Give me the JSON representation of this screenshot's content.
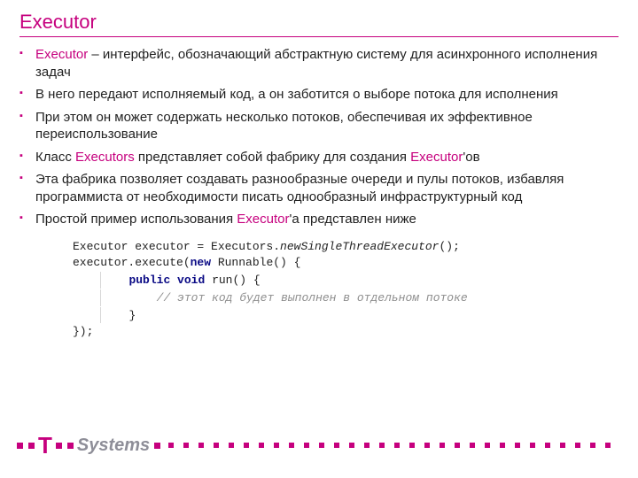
{
  "title": "Executor",
  "bullets": [
    {
      "pre": "Executor",
      "post": " – интерфейс, обозначающий абстрактную систему для асинхронного исполнения задач"
    },
    {
      "plain": "В него передают исполняемый код, а он заботится о выборе потока для исполнения"
    },
    {
      "plain": "При этом он может содержать несколько потоков, обеспечивая их эффективное переиспользование"
    },
    {
      "p1": "Класс ",
      "k1": "Executors",
      "p2": " представляет собой фабрику для создания ",
      "k2": "Executor",
      "p3": "'ов"
    },
    {
      "plain": "Эта фабрика позволяет создавать разнообразные очереди и пулы потоков, избавляя программиста от необходимости писать однообразный инфраструктурный код"
    },
    {
      "p1": "Простой пример использования ",
      "k1": "Executor",
      "p2": "'а представлен ниже"
    }
  ],
  "code": {
    "l1a": "Executor executor = Executors.",
    "l1b": "newSingleThreadExecutor",
    "l1c": "();",
    "l2a": "executor.execute(",
    "l2b": "new",
    "l2c": " Runnable() {",
    "l3a": "public void",
    "l3b": " run() {",
    "l4": "// этот код будет выполнен в отдельном потоке",
    "l5": "}",
    "l6": "});"
  },
  "brand": "Systems"
}
